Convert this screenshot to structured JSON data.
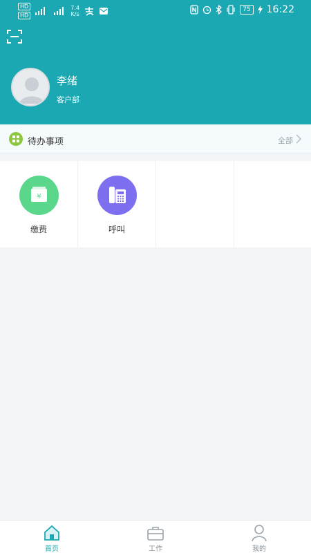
{
  "status_bar": {
    "hd1": "HD",
    "hd2": "HD",
    "net_speed": "7.4",
    "net_unit": "K/s",
    "battery": "75",
    "time": "16:22"
  },
  "profile": {
    "name": "李绪",
    "department": "客户部"
  },
  "todo": {
    "title": "待办事项",
    "all_label": "全部"
  },
  "functions": [
    {
      "label": "缴费",
      "color": "#5bd78b",
      "icon": "wallet-yen-icon"
    },
    {
      "label": "呼叫",
      "color": "#7d6ff0",
      "icon": "telephone-icon"
    }
  ],
  "tabs": [
    {
      "label": "首页",
      "icon": "home-icon",
      "active": true
    },
    {
      "label": "工作",
      "icon": "briefcase-icon",
      "active": false
    },
    {
      "label": "我的",
      "icon": "person-icon",
      "active": false
    }
  ],
  "colors": {
    "brand": "#1ba8b3",
    "background": "#f3f5f8"
  }
}
